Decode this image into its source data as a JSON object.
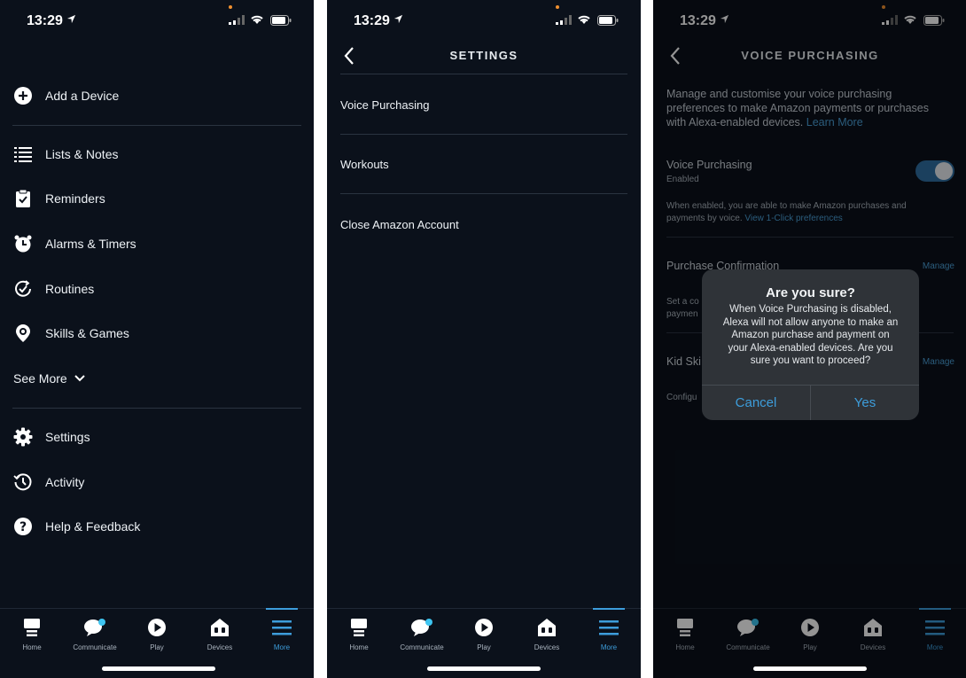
{
  "status": {
    "time": "13:29"
  },
  "panel1": {
    "menu": [
      {
        "label": "Add a Device",
        "icon": "plus-circle-icon"
      },
      {
        "label": "Lists & Notes",
        "icon": "list-icon"
      },
      {
        "label": "Reminders",
        "icon": "clipboard-check-icon"
      },
      {
        "label": "Alarms & Timers",
        "icon": "alarm-clock-icon"
      },
      {
        "label": "Routines",
        "icon": "routine-check-icon"
      },
      {
        "label": "Skills & Games",
        "icon": "location-pin-icon"
      },
      {
        "label": "See More",
        "icon": "chevron-down-icon"
      },
      {
        "label": "Settings",
        "icon": "gear-icon"
      },
      {
        "label": "Activity",
        "icon": "history-icon"
      },
      {
        "label": "Help & Feedback",
        "icon": "help-icon"
      }
    ]
  },
  "panel2": {
    "title": "SETTINGS",
    "rows": [
      "Voice Purchasing",
      "Workouts",
      "Close Amazon Account"
    ]
  },
  "panel3": {
    "title": "VOICE PURCHASING",
    "intro_line1": "Manage and customise your voice purchasing",
    "intro_line2": "preferences to make Amazon payments or purchases",
    "intro_line3": "with Alexa-enabled devices.",
    "learn_more": "Learn More",
    "vp_label": "Voice Purchasing",
    "vp_status": "Enabled",
    "vp_desc_line1": "When enabled, you are able to make Amazon purchases and",
    "vp_desc_line2": "payments by voice.",
    "vp_link": "View 1-Click preferences",
    "vp_enabled": true,
    "purchase_confirmation": "Purchase Confirmation",
    "set_partial": "Set a co",
    "paymen_partial": "paymen",
    "kid_partial": "Kid Ski",
    "config_partial": "Configu",
    "manage": "Manage",
    "dialog": {
      "title": "Are you sure?",
      "line1": "When Voice Purchasing is disabled,",
      "line2": "Alexa will not allow anyone to make an",
      "line3": "Amazon purchase and payment on",
      "line4": "your Alexa-enabled devices. Are you",
      "line5": "sure you want to proceed?",
      "cancel": "Cancel",
      "yes": "Yes"
    }
  },
  "tabs": [
    {
      "label": "Home",
      "icon": "home-icon"
    },
    {
      "label": "Communicate",
      "icon": "chat-bubble-icon"
    },
    {
      "label": "Play",
      "icon": "play-icon"
    },
    {
      "label": "Devices",
      "icon": "devices-house-icon"
    },
    {
      "label": "More",
      "icon": "hamburger-menu-icon",
      "active": true
    }
  ],
  "colors": {
    "background": "#0b111b",
    "accent": "#3d9ddb",
    "toggle_on": "#2f6fa3"
  }
}
